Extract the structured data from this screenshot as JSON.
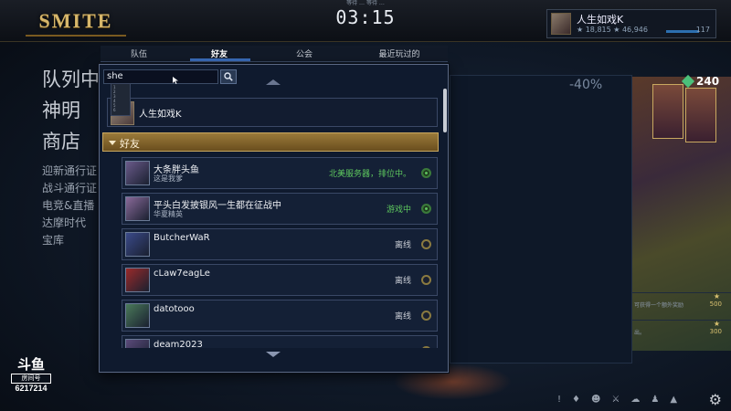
{
  "game": {
    "logo": "SMITE",
    "timer": "03:15",
    "timer_sub": "等待 …  等待 …"
  },
  "player": {
    "name": "人生如戏K",
    "stats": "★ 18,815  ★ 46,946",
    "level": "117"
  },
  "left_menu": {
    "big_items": [
      "队列中",
      "神明",
      "商店"
    ],
    "small_items": [
      "迎新通行证",
      "战斗通行证",
      "电竞&直播",
      "达摩时代",
      "宝库"
    ]
  },
  "store": {
    "discount": "-40%",
    "gems": "240",
    "rewards": [
      {
        "text": "可获得一个额外奖励",
        "value": "500"
      },
      {
        "text": "出。",
        "value": "300"
      }
    ]
  },
  "social": {
    "tabs": [
      "队伍",
      "好友",
      "公会",
      "最近玩过的"
    ],
    "active_tab": "好友",
    "search": {
      "value": "she",
      "placeholder": ""
    },
    "autocomplete_lines": [
      "1",
      "2",
      "3",
      "4",
      "5",
      "6"
    ],
    "match": {
      "name": "人生如戏K"
    },
    "section_label": "好友",
    "friends": [
      {
        "name": "大条胖头鱼",
        "sub": "这是我爹",
        "status": "北美服务器，排位中。",
        "state": "online",
        "status_color": "#5ec85e",
        "avatar_color": "#6a5a8a"
      },
      {
        "name": "平头白发披银风一生都在征战中",
        "sub": "华夏精英",
        "status": "游戏中",
        "state": "online",
        "status_color": "#5ec85e",
        "avatar_color": "#8a6a9a"
      },
      {
        "name": "ButcherWaR",
        "sub": "",
        "status": "离线",
        "state": "offline",
        "status_color": "#c8ccd4",
        "avatar_color": "#3a4a8a"
      },
      {
        "name": "cLaw7eagLe",
        "sub": "",
        "status": "离线",
        "state": "offline",
        "status_color": "#c8ccd4",
        "avatar_color": "#9a2a2a"
      },
      {
        "name": "datotooo",
        "sub": "",
        "status": "离线",
        "state": "offline",
        "status_color": "#c8ccd4",
        "avatar_color": "#4a7a5a"
      },
      {
        "name": "deam2023",
        "sub": "",
        "status": "",
        "state": "offline",
        "status_color": "#c8ccd4",
        "avatar_color": "#5a4a7a"
      }
    ]
  },
  "watermark": {
    "mark": "斗鱼",
    "label": "房间号",
    "room": "6217214"
  },
  "bottom_bar": {
    "icons": [
      "!",
      "♦",
      "☻",
      "⚔",
      "☁",
      "♟",
      "▲"
    ]
  }
}
